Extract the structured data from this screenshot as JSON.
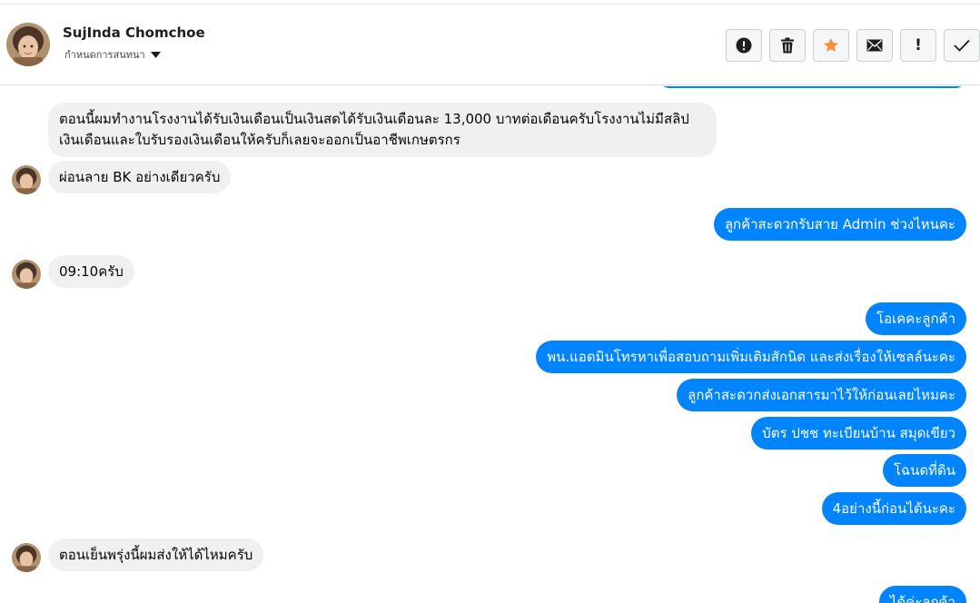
{
  "header": {
    "contact_name": "SujInda Chomchoe",
    "conversation_settings": "กำหนดการสนทนา",
    "icons": [
      "alert-circle-icon",
      "trash-icon",
      "star-icon",
      "envelope-icon",
      "exclamation-icon",
      "check-icon"
    ],
    "exclamation_label": "!"
  },
  "colors": {
    "outgoing_bubble": "#0084ff",
    "incoming_bubble": "#f0f0f0",
    "star": "#f7923b"
  },
  "messages": [
    {
      "direction": "incoming",
      "line1": "ตอนนี้ผมทำงานโรงงานได้รับเงินเดือนเป็นเงินสดได้รับเงินเดือนละ 13,000 บาทต่อเดือนครับโรงงานไม่มีสลิป",
      "line2": "เงินเดือนและใบรับรองเงินเดือนให้ครับก็เลยจะออกเป็นอาชีพเกษตรกร"
    },
    {
      "direction": "incoming",
      "text": "ผ่อนลาย BK อย่างเดียวครับ"
    },
    {
      "direction": "outgoing",
      "text": "ลูกค้าสะดวกรับสาย Admin ช่วงไหนคะ"
    },
    {
      "direction": "incoming",
      "text": "09:10ครับ"
    },
    {
      "direction": "outgoing",
      "text": "โอเคคะลูกค้า"
    },
    {
      "direction": "outgoing",
      "text": "พน.แอดมินโทรหาเพื่อสอบถามเพิ่มเติมสักนิด และส่งเรื่องให้เซลล์นะคะ"
    },
    {
      "direction": "outgoing",
      "text": "ลูกค้าสะดวกส่งเอกสารมาไว้ให้ก่อนเลยไหมคะ"
    },
    {
      "direction": "outgoing",
      "text": "บัตร ปชช ทะเบียนบ้าน สมุดเขียว"
    },
    {
      "direction": "outgoing",
      "text": "โฉนดที่ดิน"
    },
    {
      "direction": "outgoing",
      "text": "4อย่างนี้ก่อนได้นะคะ"
    },
    {
      "direction": "incoming",
      "text": "ตอนเย็นพรุ่งนี้ผมส่งให้ได้ไหมครับ"
    },
    {
      "direction": "outgoing",
      "text": "ได้ค่ะลูกค้า"
    }
  ]
}
